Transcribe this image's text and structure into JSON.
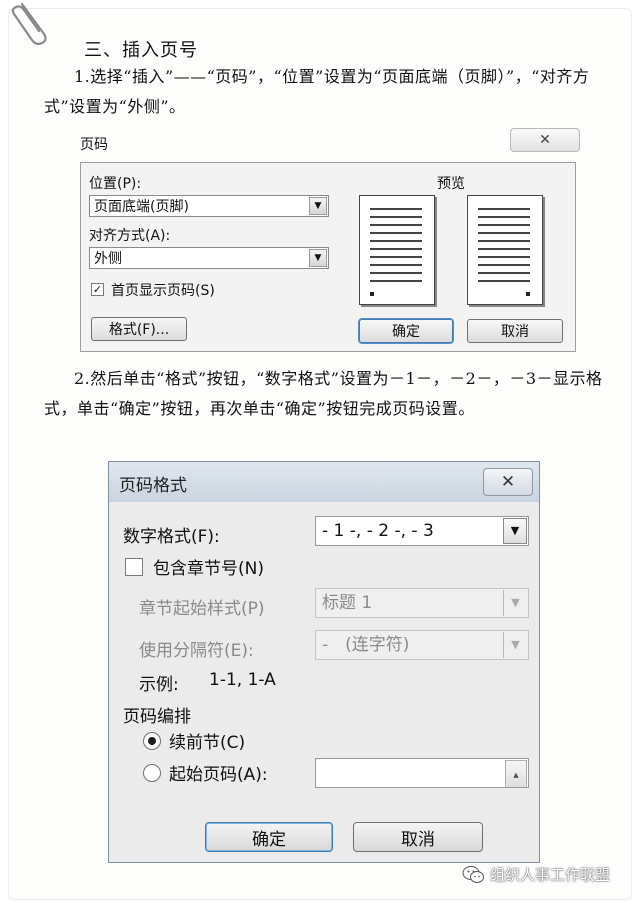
{
  "heading": "三、插入页号",
  "paragraph1": "1.选择“插入”——“页码”，“位置”设置为“页面底端（页脚）”，“对齐方式”设置为“外侧”。",
  "paragraph2": "2.然后单击“格式”按钮，“数字格式”设置为－1－，－2－，－3－显示格式，单击“确定”按钮，再次单击“确定”按钮完成页码设置。",
  "dialog1": {
    "title": "页码",
    "close_glyph": "✕",
    "position_label": "位置(P):",
    "position_value": "页面底端(页脚)",
    "alignment_label": "对齐方式(A):",
    "alignment_value": "外侧",
    "show_first_page_label": "首页显示页码(S)",
    "show_first_page_checked": true,
    "format_button": "格式(F)...",
    "preview_label": "预览",
    "ok_button": "确定",
    "cancel_button": "取消"
  },
  "dialog2": {
    "title": "页码格式",
    "close_glyph": "✕",
    "number_format_label": "数字格式(F):",
    "number_format_value": "- 1 -, - 2 -, - 3",
    "include_chapter_label": "包含章节号(N)",
    "include_chapter_checked": false,
    "chapter_style_label": "章节起始样式(P)",
    "chapter_style_value": "标题 1",
    "separator_label": "使用分隔符(E):",
    "separator_value": "-　(连字符)",
    "example_label": "示例:",
    "example_value": "1-1, 1-A",
    "numbering_section_label": "页码编排",
    "continue_label": "续前节(C)",
    "continue_selected": true,
    "start_at_label": "起始页码(A):",
    "start_at_value": "",
    "ok_button": "确定",
    "cancel_button": "取消"
  },
  "watermark": "组织人事工作联盟",
  "icons": {
    "paperclip": "paperclip-icon",
    "wechat": "wechat-icon"
  }
}
